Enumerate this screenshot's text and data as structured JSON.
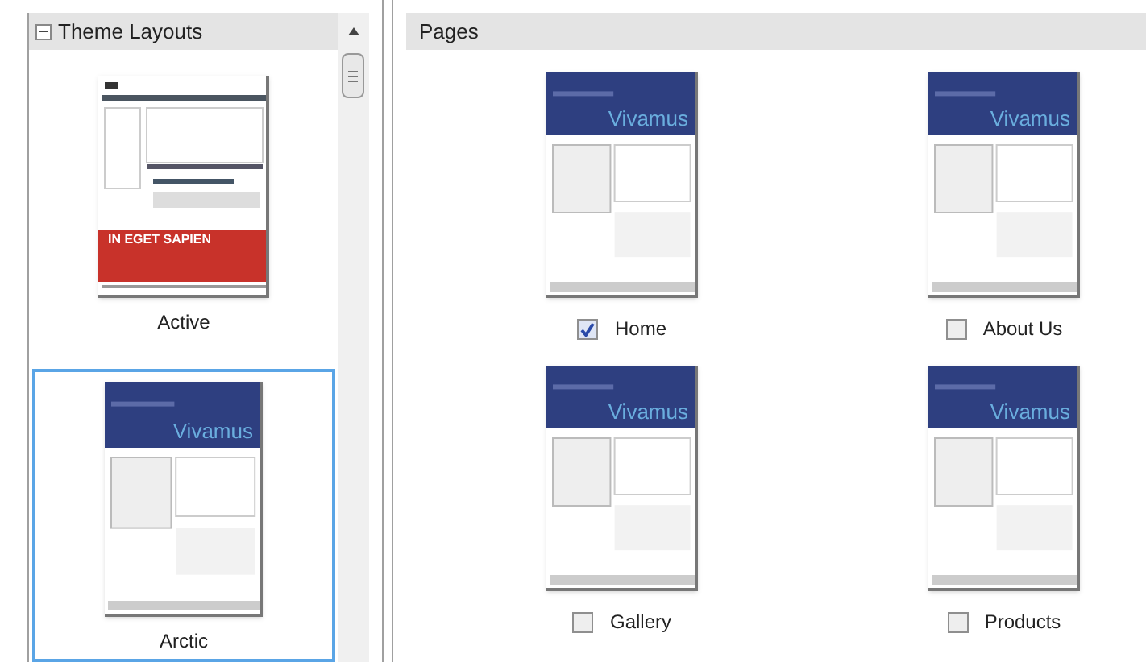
{
  "theme_panel": {
    "title": "Theme Layouts",
    "expanded": true,
    "layouts": [
      {
        "label": "Active",
        "selected": false,
        "thumbnail": {
          "kind": "red-banner",
          "heading": "IN EGET SAPIEN"
        }
      },
      {
        "label": "Arctic",
        "selected": true,
        "thumbnail": {
          "kind": "blue-header",
          "heading": "Vivamus"
        }
      }
    ]
  },
  "pages_panel": {
    "title": "Pages",
    "pages": [
      {
        "label": "Home",
        "checked": true,
        "thumbnail": {
          "kind": "blue-header",
          "heading": "Vivamus"
        }
      },
      {
        "label": "About Us",
        "checked": false,
        "thumbnail": {
          "kind": "blue-header",
          "heading": "Vivamus"
        }
      },
      {
        "label": "Gallery",
        "checked": false,
        "thumbnail": {
          "kind": "blue-header",
          "heading": "Vivamus"
        }
      },
      {
        "label": "Products",
        "checked": false,
        "thumbnail": {
          "kind": "blue-header",
          "heading": "Vivamus"
        }
      }
    ]
  }
}
